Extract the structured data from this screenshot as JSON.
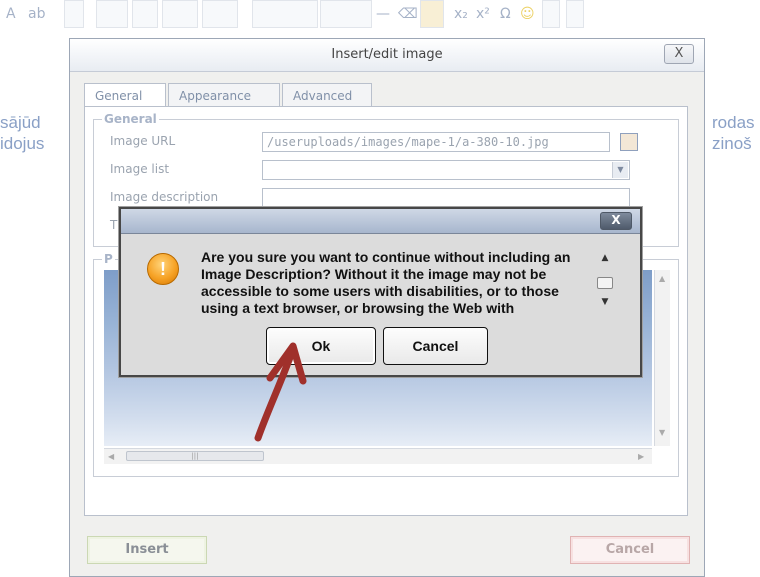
{
  "toolbar": {
    "icons": [
      "text-color-icon",
      "highlight-color-icon",
      "table-icon",
      "insert-row-icon",
      "insert-col-icon",
      "split-cells-icon",
      "merge-cells-icon",
      "style-icon",
      "rule-icon",
      "horizontal-rule-icon",
      "remove-format-icon",
      "visual-aid-icon",
      "subscript-icon",
      "superscript-icon",
      "special-char-icon",
      "emotions-icon",
      "media-icon",
      "print-icon"
    ]
  },
  "background": {
    "left_line1": "sājūd",
    "left_line2": "idojus",
    "right_line1": "rodas",
    "right_line2": "zinoš"
  },
  "image_dialog": {
    "title": "Insert/edit image",
    "close_label": "X",
    "tabs": [
      {
        "label": "General",
        "active": true
      },
      {
        "label": "Appearance",
        "active": false
      },
      {
        "label": "Advanced",
        "active": false
      }
    ],
    "general_legend": "General",
    "fields": {
      "image_url": {
        "label": "Image URL",
        "value": "/useruploads/images/mape-1/a-380-10.jpg"
      },
      "image_list": {
        "label": "Image list",
        "value": ""
      },
      "image_description": {
        "label": "Image description",
        "value": ""
      },
      "title": {
        "label": "T",
        "value": ""
      }
    },
    "preview_legend": "P",
    "insert_label": "Insert",
    "cancel_label": "Cancel"
  },
  "message_box": {
    "close_label": "X",
    "icon": "warning-icon",
    "text": "Are you sure you want to continue without including an Image Description? Without it the image may not be accessible to some users with disabilities, or to those using a text browser, or browsing the Web with",
    "ok_label": "Ok",
    "cancel_label": "Cancel"
  },
  "colors": {
    "arrow": "#a0302b",
    "warning": "#f6a225"
  }
}
